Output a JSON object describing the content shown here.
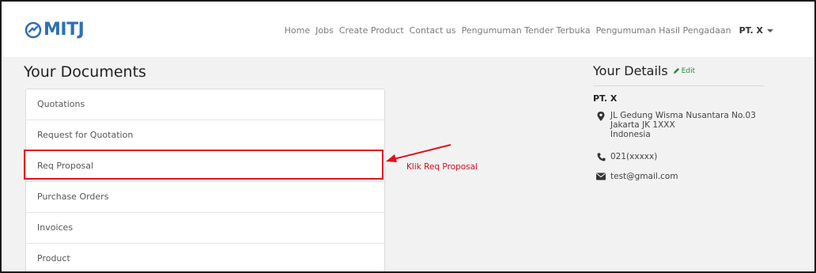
{
  "brand": {
    "logo_text": "MITJ"
  },
  "nav": {
    "links": [
      "Home",
      "Jobs",
      "Create Product",
      "Contact us",
      "Pengumuman Tender Terbuka",
      "Pengumuman Hasil Pengadaan"
    ],
    "user": "PT. X"
  },
  "documents": {
    "title": "Your Documents",
    "items": [
      "Quotations",
      "Request for Quotation",
      "Req Proposal",
      "Purchase Orders",
      "Invoices",
      "Product"
    ]
  },
  "annotation": {
    "text": "Klik Req Proposal",
    "color": "#e0101a"
  },
  "details": {
    "title": "Your Details",
    "edit_label": "Edit",
    "company": "PT. X",
    "address_line1": "JL Gedung Wisma Nusantara No.03",
    "address_line2": "Jakarta JK 1XXX",
    "address_line3": "Indonesia",
    "phone": "021(xxxxx)",
    "email": "test@gmail.com"
  },
  "icons": [
    "map-marker-icon",
    "phone-icon",
    "envelope-icon",
    "pencil-icon",
    "chevron-down-icon"
  ]
}
